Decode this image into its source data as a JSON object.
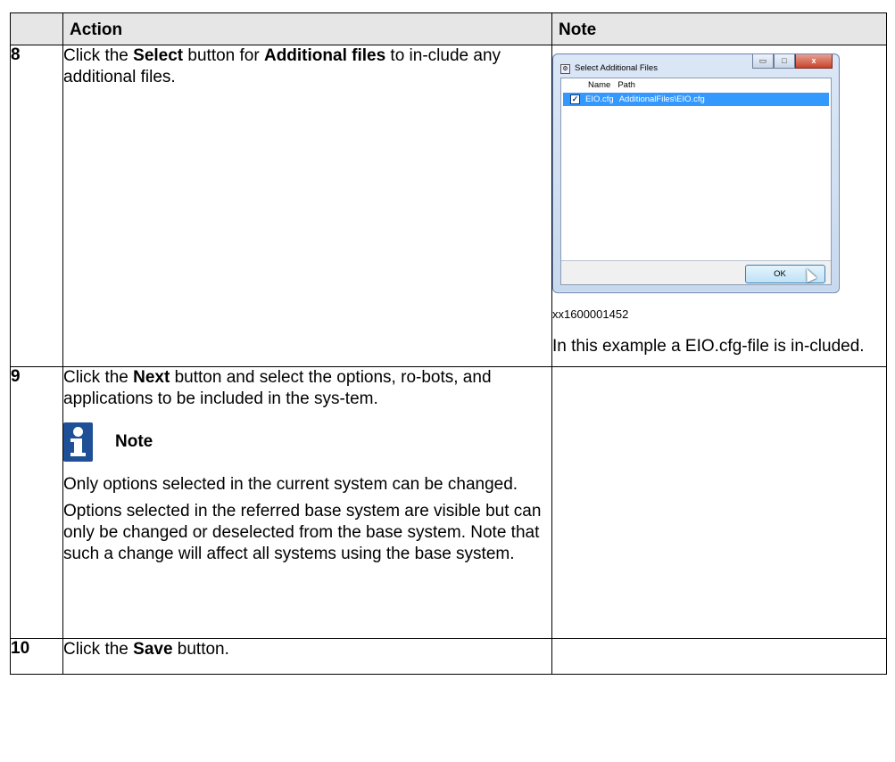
{
  "header": {
    "num": "",
    "action": "Action",
    "note": "Note"
  },
  "rows": [
    {
      "num": "8",
      "action": {
        "pre": "Click the ",
        "b1": "Select",
        "mid": " button for ",
        "b2": "Additional files",
        "post": " to in-clude any additional files."
      },
      "note": {
        "dialog": {
          "title": "Select Additional Files",
          "col_name": "Name",
          "col_path": "Path",
          "row_name": "EIO.cfg",
          "row_path": "AdditionalFiles\\EIO.cfg",
          "ok_label": "OK",
          "min_glyph": "▭",
          "max_glyph": "□",
          "close_glyph": "x"
        },
        "figure_id": "xx1600001452",
        "text": "In this example a EIO.cfg-file is in-cluded."
      }
    },
    {
      "num": "9",
      "action": {
        "pre": "Click the ",
        "b1": "Next",
        "post": " button and select the options, ro-bots, and applications to be included in the sys-tem.",
        "note_label": "Note",
        "p1": "Only options selected in the current system can be changed.",
        "p2": "Options selected in the referred base system are visible but can only be changed or deselected from the base system. Note that such a change will affect all systems using the base system."
      }
    },
    {
      "num": "10",
      "action": {
        "pre": "Click the ",
        "b1": "Save",
        "post": " button."
      }
    }
  ]
}
